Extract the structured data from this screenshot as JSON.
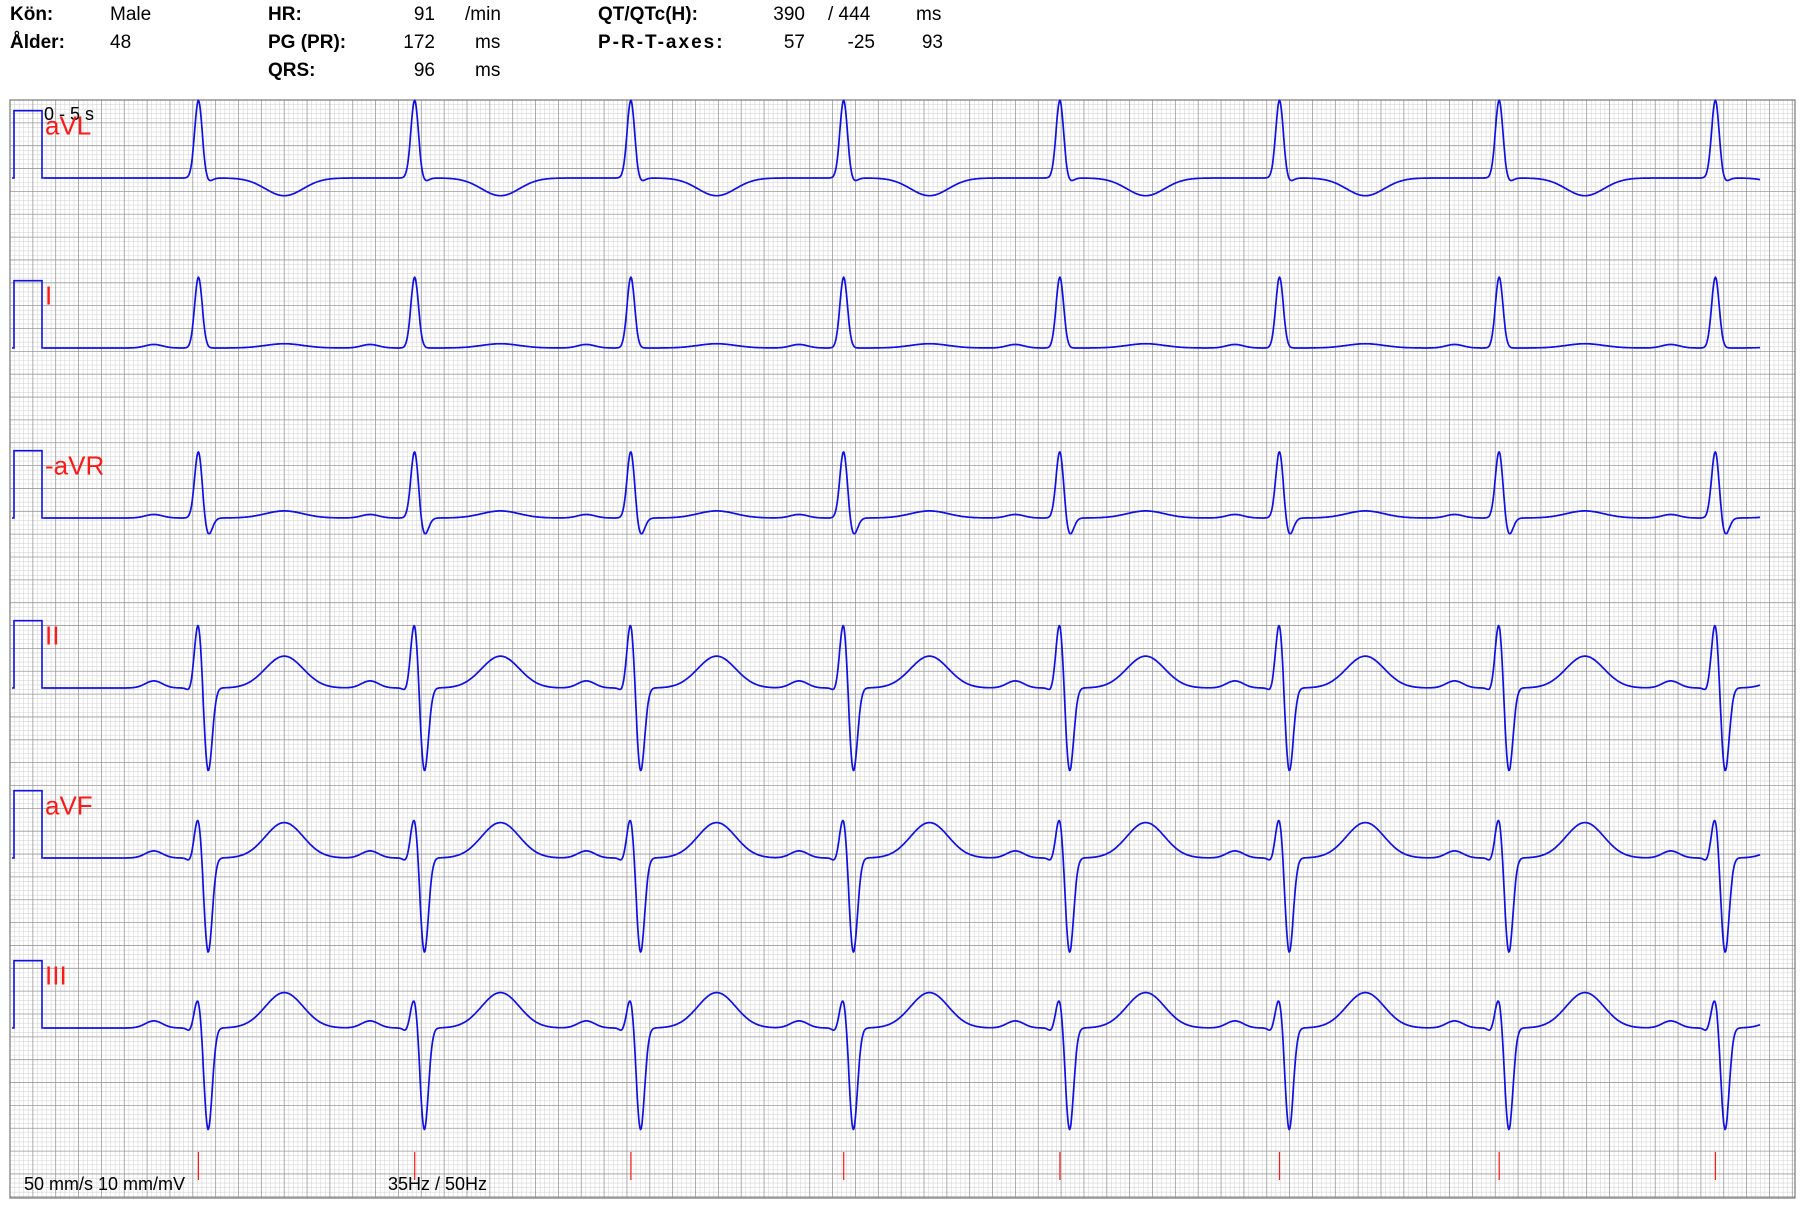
{
  "header": {
    "sex_label": "Kön:",
    "sex_value": "Male",
    "age_label": "Ålder:",
    "age_value": "48",
    "hr_label": "HR:",
    "hr_value": "91",
    "hr_unit": "/min",
    "pr_label": "PG (PR):",
    "pr_value": "172",
    "pr_unit": "ms",
    "qrs_label": "QRS:",
    "qrs_value": "96",
    "qrs_unit": "ms",
    "qt_label": "QT/QTc(H):",
    "qt_value": "390",
    "qtc_value": "/ 444",
    "qt_unit": "ms",
    "axes_label": "P-R-T-axes:",
    "axis_p": "57",
    "axis_r": "-25",
    "axis_t": "93"
  },
  "chart_data": {
    "type": "line",
    "time_range_label": "0 - 5 s",
    "footer_speed": "50 mm/s 10 mm/mV",
    "footer_filter": "35Hz / 50Hz",
    "x_range_s": [
      0,
      5
    ],
    "beat_times_s": [
      0.45,
      1.08,
      1.71,
      2.33,
      2.96,
      3.6,
      4.24,
      4.87
    ],
    "trace_color": "#1010e0",
    "label_color": "#ff1a1a",
    "grid_minor_color": "#d7d7d7",
    "grid_major_color": "#9a9a9a",
    "leads": [
      {
        "name": "aVL",
        "p": 0.0,
        "q": 0.0,
        "r": 1.1,
        "s": -0.05,
        "t": -0.25
      },
      {
        "name": "I",
        "p": 0.05,
        "q": 0.0,
        "r": 1.0,
        "s": 0.0,
        "t": 0.06
      },
      {
        "name": "-aVR",
        "p": 0.05,
        "q": 0.0,
        "r": 0.95,
        "s": -0.25,
        "t": 0.1
      },
      {
        "name": "II",
        "p": 0.1,
        "q": -0.05,
        "r": 0.95,
        "s": -1.2,
        "t": 0.45
      },
      {
        "name": "aVF",
        "p": 0.1,
        "q": -0.05,
        "r": 0.6,
        "s": -1.35,
        "t": 0.5
      },
      {
        "name": "III",
        "p": 0.1,
        "q": -0.05,
        "r": 0.45,
        "s": -1.45,
        "t": 0.5
      }
    ]
  }
}
